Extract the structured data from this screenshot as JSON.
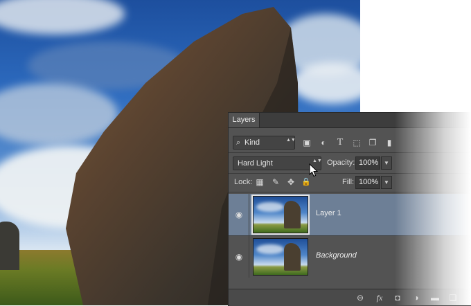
{
  "panel": {
    "tab_label": "Layers",
    "filter": {
      "value": "Kind",
      "search_glyph": "⌕",
      "arrows": "▲▼"
    },
    "filter_icons": [
      "image-filter-icon",
      "adjustment-filter-icon",
      "type-filter-icon",
      "shape-filter-icon",
      "smart-object-filter-icon",
      "filter-toggle-icon"
    ],
    "filter_glyphs": [
      "▣",
      "◐",
      "T",
      "⬚",
      "❐",
      "▮"
    ],
    "blend": {
      "value": "Hard Light",
      "arrows": "▲▼"
    },
    "opacity": {
      "label": "Opacity:",
      "value": "100%"
    },
    "lock": {
      "label": "Lock:",
      "icons": [
        "lock-transparent-pixels-icon",
        "lock-image-pixels-icon",
        "lock-position-icon",
        "lock-all-icon"
      ],
      "glyphs": [
        "▦",
        "✎",
        "✥",
        "🔒"
      ]
    },
    "fill": {
      "label": "Fill:",
      "value": "100%"
    },
    "dropdown_glyph": "▼",
    "layers": [
      {
        "name": "Layer 1",
        "selected": true,
        "visible_glyph": "◉"
      },
      {
        "name": "Background",
        "selected": false,
        "visible_glyph": "◉"
      }
    ],
    "footer_icons": [
      "link-layers-icon",
      "layer-style-fx-icon",
      "add-mask-icon",
      "adjustment-layer-icon",
      "new-group-icon",
      "new-layer-icon"
    ],
    "footer_glyphs": [
      "⊖",
      "fx",
      "◘",
      "◑",
      "▬",
      "❑"
    ]
  },
  "colors": {
    "panel_bg": "#535353",
    "selected_row": "#6d7f96"
  }
}
